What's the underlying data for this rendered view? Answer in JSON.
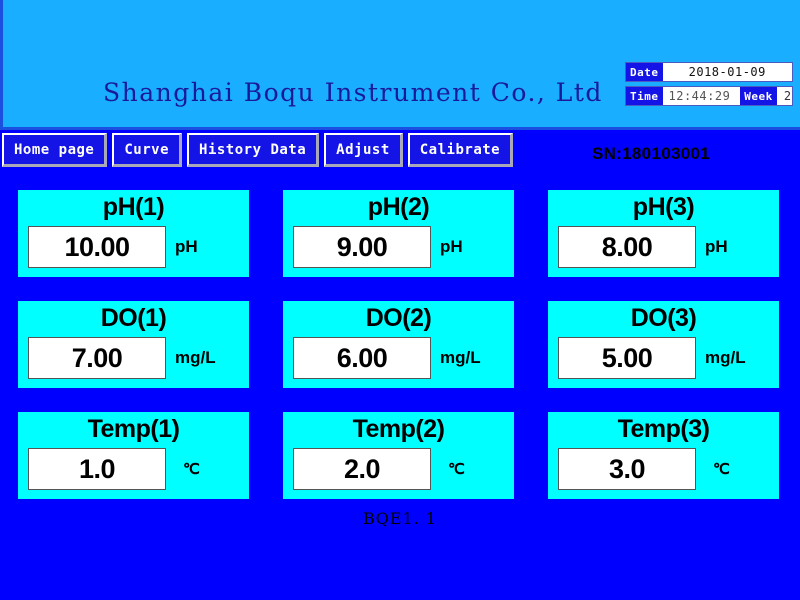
{
  "banner": {
    "title": "Shanghai Boqu Instrument Co., Ltd",
    "background_color": "#19aeff",
    "title_color": "#1a1a99"
  },
  "datetime": {
    "date_label": "Date",
    "date_value": "2018-01-09",
    "time_label": "Time",
    "time_value": "12:44:29",
    "week_label": "Week",
    "week_value": "2"
  },
  "nav": {
    "buttons": [
      {
        "label": "Home page",
        "name": "nav-home-page"
      },
      {
        "label": "Curve",
        "name": "nav-curve"
      },
      {
        "label": "History Data",
        "name": "nav-history-data"
      },
      {
        "label": "Adjust",
        "name": "nav-adjust"
      },
      {
        "label": "Calibrate",
        "name": "nav-calibrate"
      }
    ]
  },
  "serial": {
    "label": "SN:180103001"
  },
  "panels": [
    {
      "title": "pH(1)",
      "value": "10.00",
      "unit": "pH"
    },
    {
      "title": "pH(2)",
      "value": "9.00",
      "unit": "pH"
    },
    {
      "title": "pH(3)",
      "value": "8.00",
      "unit": "pH"
    },
    {
      "title": "DO(1)",
      "value": "7.00",
      "unit": "mg/L"
    },
    {
      "title": "DO(2)",
      "value": "6.00",
      "unit": "mg/L"
    },
    {
      "title": "DO(3)",
      "value": "5.00",
      "unit": "mg/L"
    },
    {
      "title": "Temp(1)",
      "value": "1.0",
      "unit": "℃"
    },
    {
      "title": "Temp(2)",
      "value": "2.0",
      "unit": "℃"
    },
    {
      "title": "Temp(3)",
      "value": "3.0",
      "unit": "℃"
    }
  ],
  "footer": {
    "version": "BQE1. 1"
  },
  "colors": {
    "screen_background": "#0000ff",
    "panel_background": "#00ffff",
    "button_background": "#1414e6",
    "value_box_background": "#ffffff"
  }
}
